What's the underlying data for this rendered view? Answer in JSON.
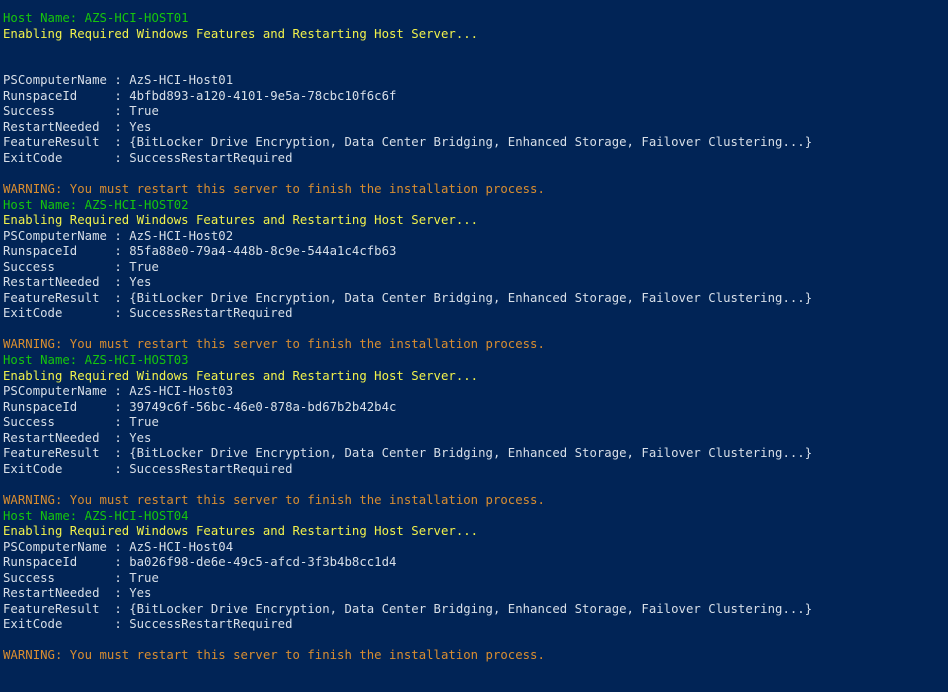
{
  "console": {
    "background_color": "#012456",
    "default_text_color": "#d8dfe8",
    "host_name_color": "#16c60c",
    "status_color": "#f2f24b",
    "warning_color": "#d98d30",
    "labels": {
      "host_name_prefix": "Host Name: ",
      "enabling_message": "Enabling Required Windows Features and Restarting Host Server...",
      "warning_message": "WARNING: You must restart this server to finish the installation process.",
      "pscomputername_label": "PSComputerName",
      "runspaceid_label": "RunspaceId",
      "success_label": "Success",
      "restartneeded_label": "RestartNeeded",
      "featureresult_label": "FeatureResult",
      "exitcode_label": "ExitCode",
      "separator": " : "
    },
    "blocks": [
      {
        "host_name": "AZS-HCI-HOST01",
        "enabling": "Enabling Required Windows Features and Restarting Host Server...",
        "blank_lines_after_enabling": 2,
        "pscomputername": "AzS-HCI-Host01",
        "runspaceid": "4bfbd893-a120-4101-9e5a-78cbc10f6c6f",
        "success": "True",
        "restartneeded": "Yes",
        "featureresult": "{BitLocker Drive Encryption, Data Center Bridging, Enhanced Storage, Failover Clustering...}",
        "exitcode": "SuccessRestartRequired",
        "warning": "WARNING: You must restart this server to finish the installation process."
      },
      {
        "host_name": "AZS-HCI-HOST02",
        "enabling": "Enabling Required Windows Features and Restarting Host Server...",
        "blank_lines_after_enabling": 0,
        "pscomputername": "AzS-HCI-Host02",
        "runspaceid": "85fa88e0-79a4-448b-8c9e-544a1c4cfb63",
        "success": "True",
        "restartneeded": "Yes",
        "featureresult": "{BitLocker Drive Encryption, Data Center Bridging, Enhanced Storage, Failover Clustering...}",
        "exitcode": "SuccessRestartRequired",
        "warning": "WARNING: You must restart this server to finish the installation process."
      },
      {
        "host_name": "AZS-HCI-HOST03",
        "enabling": "Enabling Required Windows Features and Restarting Host Server...",
        "blank_lines_after_enabling": 0,
        "pscomputername": "AzS-HCI-Host03",
        "runspaceid": "39749c6f-56bc-46e0-878a-bd67b2b42b4c",
        "success": "True",
        "restartneeded": "Yes",
        "featureresult": "{BitLocker Drive Encryption, Data Center Bridging, Enhanced Storage, Failover Clustering...}",
        "exitcode": "SuccessRestartRequired",
        "warning": "WARNING: You must restart this server to finish the installation process."
      },
      {
        "host_name": "AZS-HCI-HOST04",
        "enabling": "Enabling Required Windows Features and Restarting Host Server...",
        "blank_lines_after_enabling": 0,
        "pscomputername": "AzS-HCI-Host04",
        "runspaceid": "ba026f98-de6e-49c5-afcd-3f3b4b8cc1d4",
        "success": "True",
        "restartneeded": "Yes",
        "featureresult": "{BitLocker Drive Encryption, Data Center Bridging, Enhanced Storage, Failover Clustering...}",
        "exitcode": "SuccessRestartRequired",
        "warning": "WARNING: You must restart this server to finish the installation process."
      }
    ]
  }
}
